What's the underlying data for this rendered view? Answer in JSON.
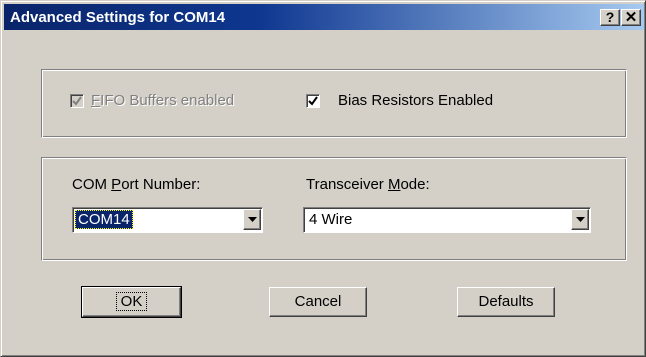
{
  "window": {
    "title": "Advanced Settings for COM14",
    "help_glyph": "?",
    "close_glyph": "✕"
  },
  "options": {
    "fifo": {
      "label": "FIFO Buffers enabled",
      "checked": true,
      "enabled": false,
      "mnemonic": "F"
    },
    "bias": {
      "label": "Bias Resistors Enabled",
      "checked": true,
      "enabled": true
    }
  },
  "com_port": {
    "label": "COM Port Number:",
    "value": "COM14"
  },
  "transceiver": {
    "label": "Transceiver Mode:",
    "value": "4 Wire"
  },
  "buttons": {
    "ok": "OK",
    "cancel": "Cancel",
    "defaults": "Defaults"
  },
  "icons": {
    "checkmark": "check-icon",
    "dropdown": "dropdown-arrow-icon"
  },
  "colors": {
    "title_bar_start": "#0a246a",
    "title_bar_end": "#a6caf0",
    "face": "#d4d0c8",
    "selection": "#0a246a"
  }
}
